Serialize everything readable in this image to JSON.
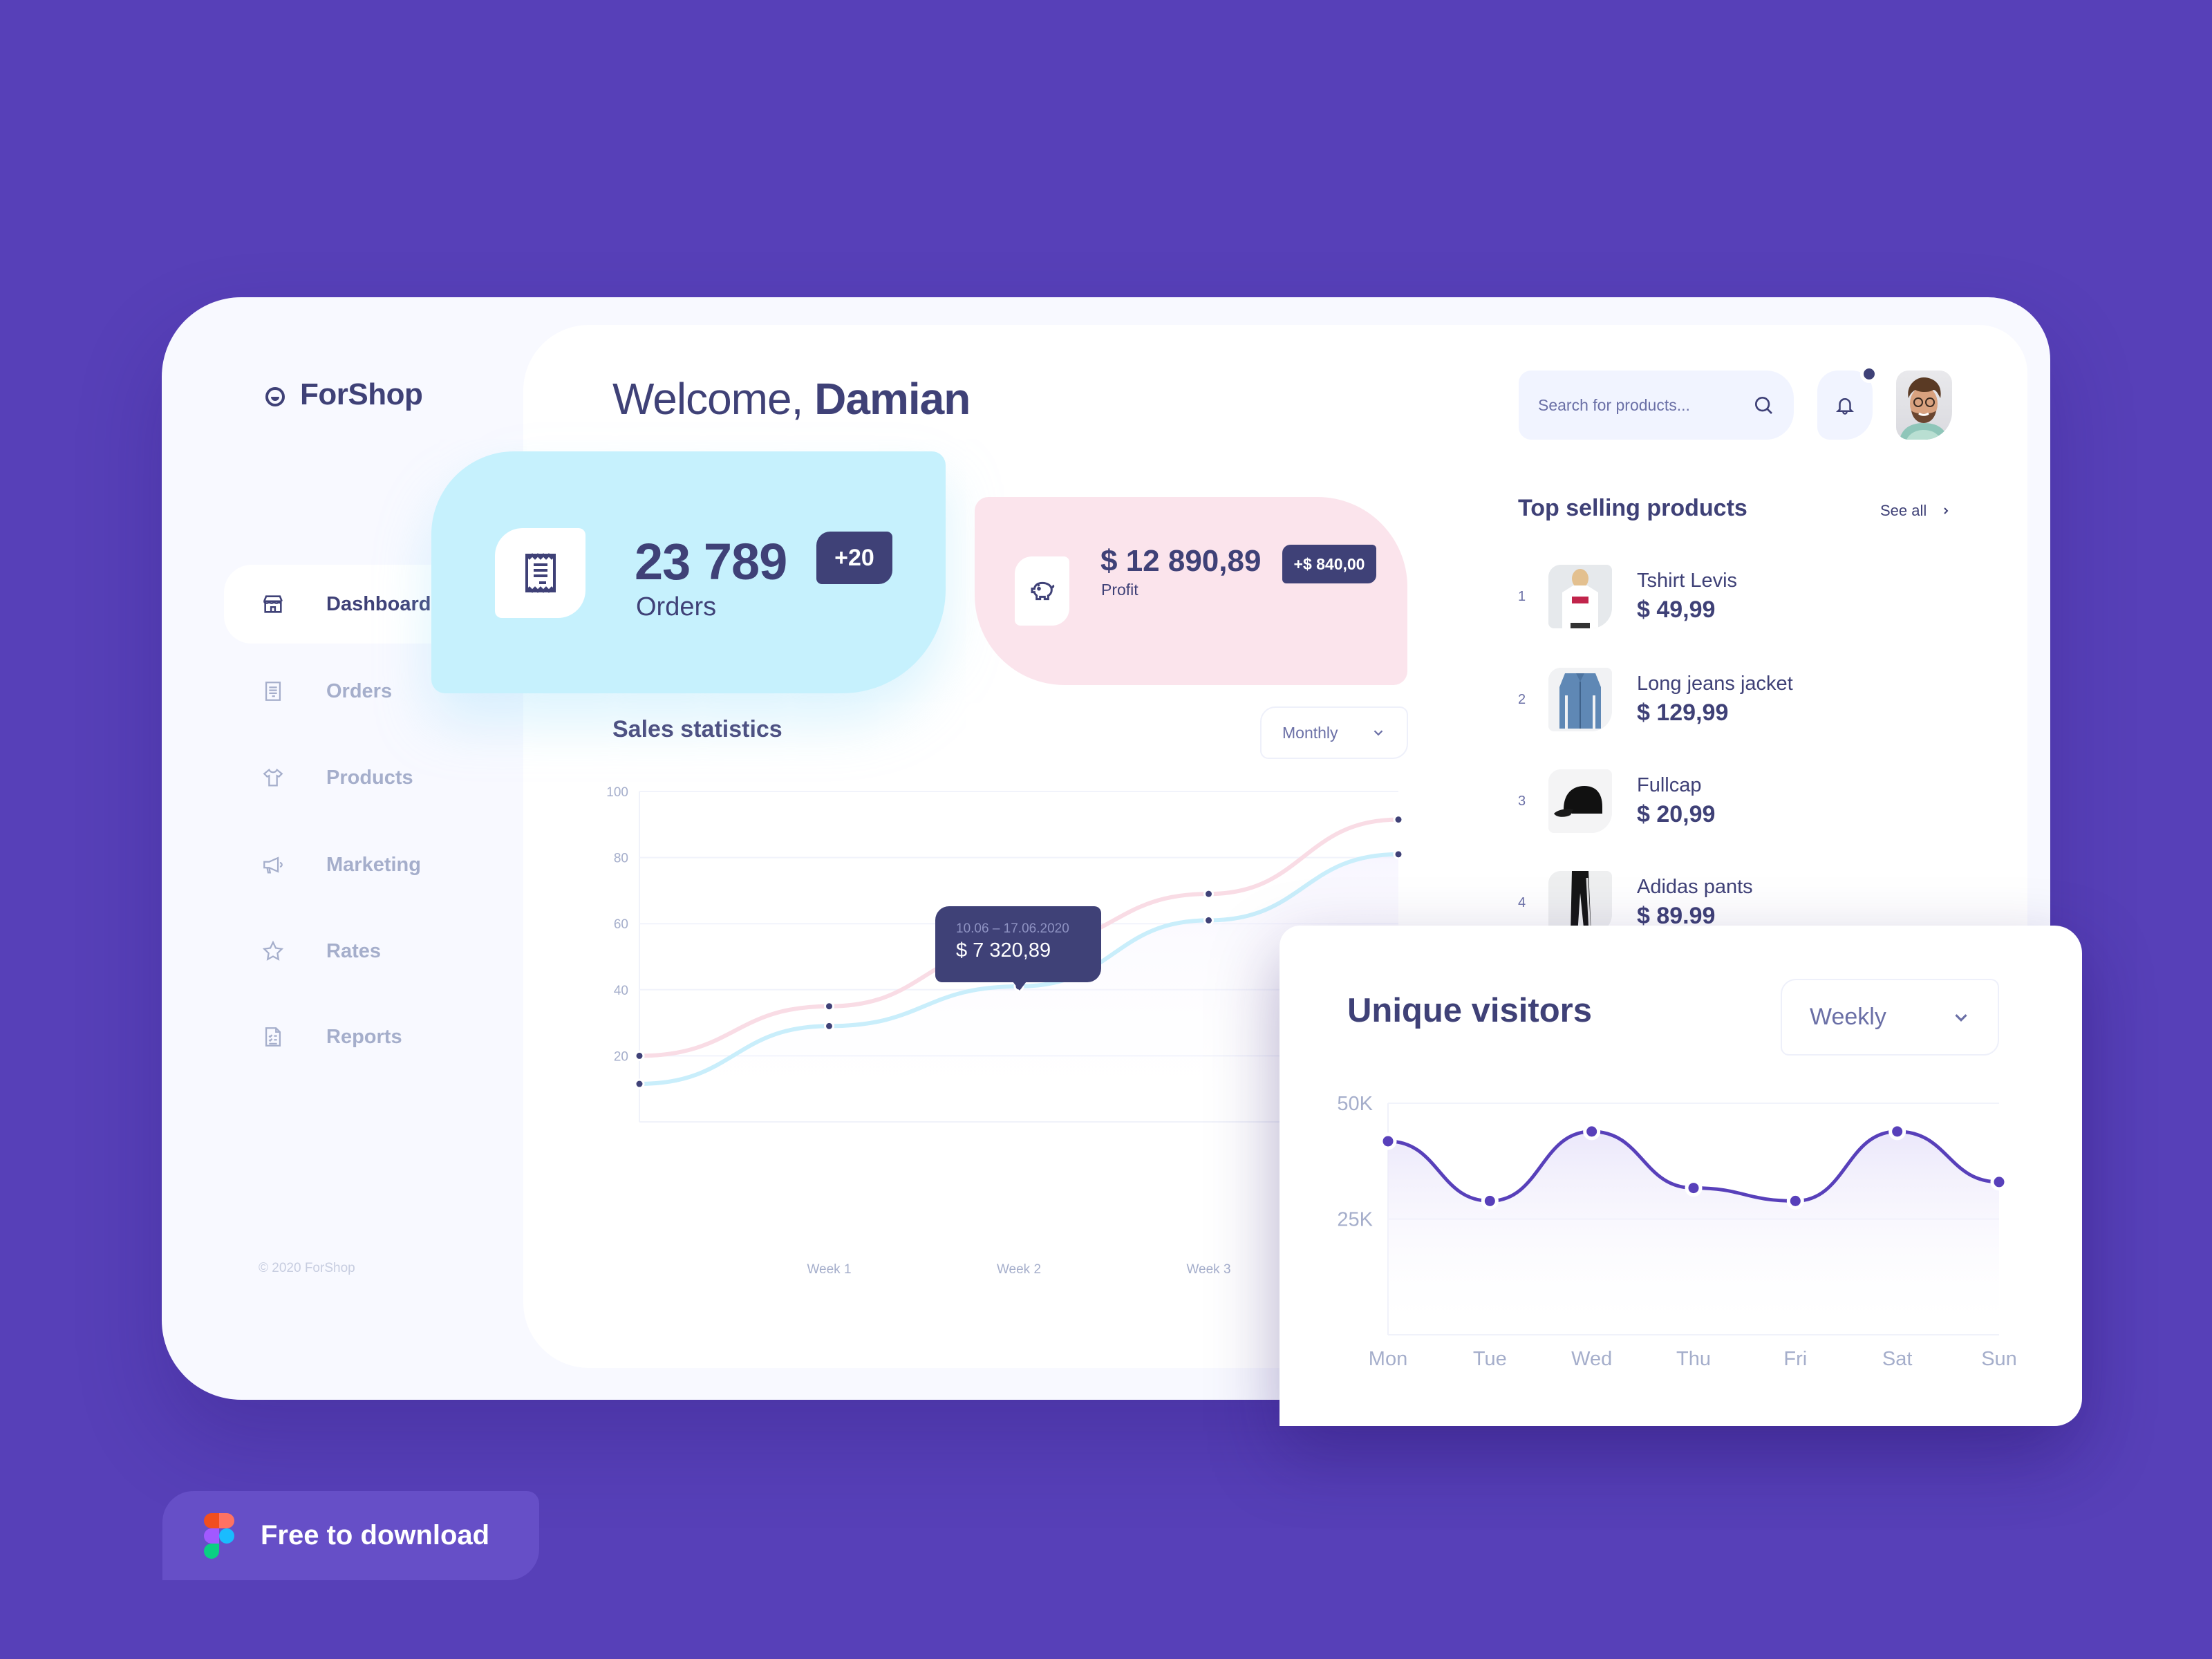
{
  "app": {
    "name": "ForShop",
    "copyright": "© 2020 ForShop"
  },
  "sidebar": {
    "items": [
      {
        "label": "Dashboard",
        "icon": "store-icon",
        "active": true
      },
      {
        "label": "Orders",
        "icon": "receipt-icon",
        "active": false
      },
      {
        "label": "Products",
        "icon": "tshirt-icon",
        "active": false
      },
      {
        "label": "Marketing",
        "icon": "megaphone-icon",
        "active": false
      },
      {
        "label": "Rates",
        "icon": "star-icon",
        "active": false
      },
      {
        "label": "Reports",
        "icon": "report-icon",
        "active": false
      }
    ]
  },
  "header": {
    "greeting": "Welcome,",
    "user_name": "Damian",
    "search_placeholder": "Search for products...",
    "has_notification": true
  },
  "stats": {
    "orders": {
      "value": "23 789",
      "badge": "+20",
      "label": "Orders"
    },
    "profit": {
      "value": "$ 12 890,89",
      "badge": "+$ 840,00",
      "label": "Profit"
    }
  },
  "sales": {
    "title": "Sales statistics",
    "period": "Monthly",
    "tooltip": {
      "date_range": "10.06 – 17.06.2020",
      "value": "$ 7 320,89"
    }
  },
  "top_selling": {
    "title": "Top selling products",
    "see_all": "See all",
    "products": [
      {
        "rank": "1",
        "name": "Tshirt Levis",
        "price": "$ 49,99",
        "thumb": "tshirt"
      },
      {
        "rank": "2",
        "name": "Long jeans jacket",
        "price": "$ 129,99",
        "thumb": "jacket"
      },
      {
        "rank": "3",
        "name": "Fullcap",
        "price": "$ 20,99",
        "thumb": "cap"
      },
      {
        "rank": "4",
        "name": "Adidas pants",
        "price": "$ 89.99",
        "thumb": "pants"
      }
    ]
  },
  "visitors": {
    "title": "Unique visitors",
    "period": "Weekly"
  },
  "cta": {
    "label": "Free to download"
  },
  "colors": {
    "background": "#5740B8",
    "primary_text": "#3F4177",
    "muted_text": "#A5AECB",
    "orders_card": "#C6F1FD",
    "profit_card": "#FBE4EC",
    "sales_series_pink": "#F9DCE5",
    "sales_series_blue": "#C9EEFB",
    "visitors_line": "#5840BA"
  },
  "chart_data": [
    {
      "type": "line",
      "title": "Sales statistics",
      "x": [
        "",
        "Week 1",
        "Week 2",
        "Week 3",
        ""
      ],
      "yticks": [
        20,
        40,
        60,
        80,
        100
      ],
      "ylim": [
        0,
        100
      ],
      "grid": true,
      "series": [
        {
          "name": "series-pink",
          "values": [
            20,
            35,
            53,
            69,
            91.5
          ]
        },
        {
          "name": "series-blue",
          "values": [
            11.5,
            29,
            41,
            61,
            81
          ]
        }
      ],
      "highlight": {
        "series": 0,
        "index": 2
      }
    },
    {
      "type": "area",
      "title": "Unique visitors",
      "categories": [
        "Mon",
        "Tue",
        "Wed",
        "Thu",
        "Fri",
        "Sat",
        "Sun"
      ],
      "yticks": [
        "25K",
        "50K"
      ],
      "ytick_values": [
        25000,
        50000
      ],
      "ylim": [
        0,
        50000
      ],
      "grid": true,
      "values": [
        41800,
        28900,
        43900,
        31700,
        28900,
        43900,
        33000
      ]
    }
  ]
}
